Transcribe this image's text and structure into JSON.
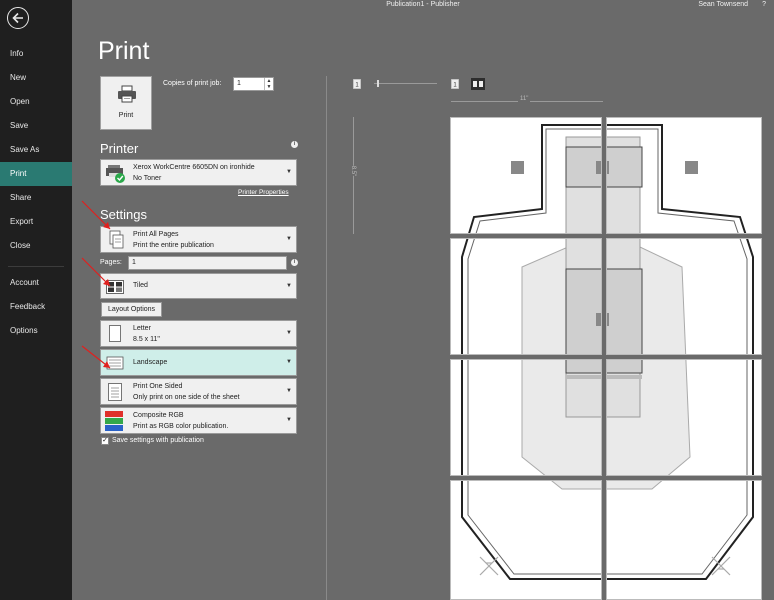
{
  "titlebar": {
    "title": "Publication1  -  Publisher",
    "user": "Sean Townsend",
    "help": "?"
  },
  "nav": {
    "items": [
      {
        "label": "Info"
      },
      {
        "label": "New"
      },
      {
        "label": "Open"
      },
      {
        "label": "Save"
      },
      {
        "label": "Save As"
      },
      {
        "label": "Print"
      },
      {
        "label": "Share"
      },
      {
        "label": "Export"
      },
      {
        "label": "Close"
      },
      {
        "label": "Account"
      },
      {
        "label": "Feedback"
      },
      {
        "label": "Options"
      }
    ],
    "active": "Print"
  },
  "page": {
    "title": "Print"
  },
  "print": {
    "button_label": "Print",
    "copies_label": "Copies of print job:",
    "copies_value": "1"
  },
  "printer": {
    "header": "Printer",
    "name": "Xerox WorkCentre 6605DN on ironhide",
    "status": "No Toner",
    "properties_link": "Printer Properties"
  },
  "settings": {
    "header": "Settings",
    "pages_option": {
      "title": "Print All Pages",
      "desc": "Print the entire publication"
    },
    "pages_label": "Pages:",
    "pages_value": "1",
    "layout": {
      "title": "Tiled"
    },
    "layout_options_button": "Layout Options",
    "paper": {
      "title": "Letter",
      "desc": "8.5 x 11\""
    },
    "orientation": {
      "title": "Landscape"
    },
    "sides": {
      "title": "Print One Sided",
      "desc": "Only print on one side of the sheet"
    },
    "color": {
      "title": "Composite RGB",
      "desc": "Print as RGB color publication."
    },
    "save_settings": {
      "label": "Save settings with publication",
      "checked": true
    }
  },
  "preview": {
    "ruler_h_label": "11\"",
    "ruler_v_label": "8.5\""
  },
  "colors": {
    "accent": "#2a7a72",
    "sidebar": "#1f1f1f",
    "background": "#6a6a6a",
    "annotation": "#e0201e"
  }
}
